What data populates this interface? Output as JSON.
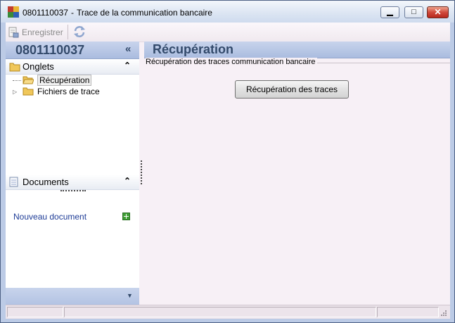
{
  "window": {
    "title_number": "0801110037",
    "title_separator": "-",
    "title_text": "Trace de la communication bancaire",
    "minimize_glyph": "▁",
    "maximize_glyph": "□",
    "close_glyph": "✕"
  },
  "toolbar": {
    "save_label": "Enregistrer",
    "save_icon": "save-document-icon",
    "refresh_icon": "refresh-icon"
  },
  "sidebar": {
    "header_number": "0801110037",
    "collapse_glyph": "«",
    "tabs_section": {
      "label": "Onglets",
      "chevron": "⌃",
      "items": [
        {
          "label": "Récupération",
          "selected": true
        },
        {
          "label": "Fichiers de trace",
          "selected": false
        }
      ]
    },
    "documents_section": {
      "label": "Documents",
      "chevron": "⌃",
      "new_document_link": "Nouveau document"
    },
    "footer_arrow": "▼"
  },
  "main": {
    "title": "Récupération",
    "group_label": "Récupération des traces communication bancaire",
    "action_button": "Récupération des traces"
  },
  "colors": {
    "accent_header": "#334a6b",
    "link": "#1d3b96",
    "panel_bg": "#f7f0f6"
  }
}
